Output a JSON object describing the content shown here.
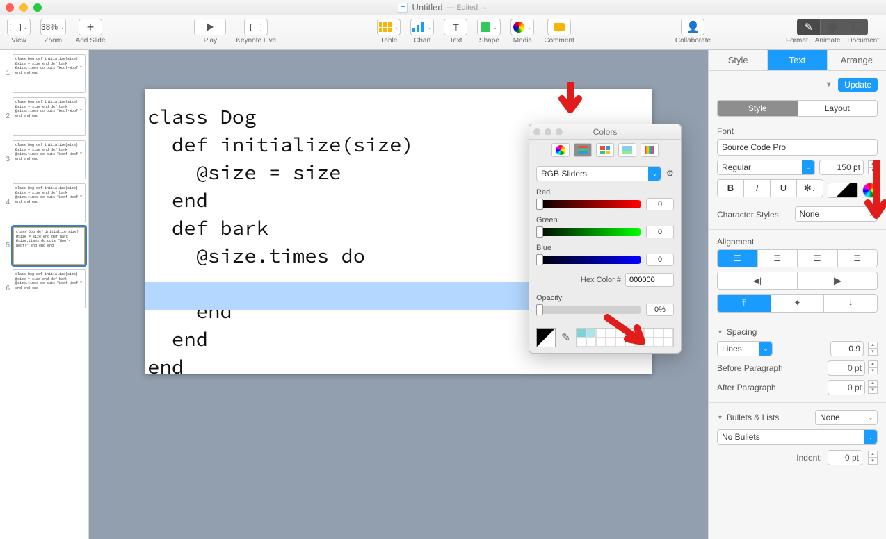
{
  "window": {
    "title": "Untitled",
    "edited_suffix": "— Edited"
  },
  "toolbar": {
    "view": "View",
    "zoom": "Zoom",
    "zoom_value": "38%",
    "add_slide": "Add Slide",
    "play": "Play",
    "keynote_live": "Keynote Live",
    "table": "Table",
    "chart": "Chart",
    "text": "Text",
    "shape": "Shape",
    "media": "Media",
    "comment": "Comment",
    "collaborate": "Collaborate",
    "format": "Format",
    "animate": "Animate",
    "document": "Document"
  },
  "slide_code": "class Dog\n  def initialize(size)\n    @size = size\n  end\n  def bark\n    @size.times do\n\n    end\n  end\nend",
  "thumb_code": "class Dog\n def initialize(size)\n  @size = size\n end\n def bark\n  @size.times do\n   puts \"Woof-Woof!\"\n  end\n end\nend",
  "inspector": {
    "tabs": {
      "style": "Style",
      "text": "Text",
      "arrange": "Arrange"
    },
    "update": "Update",
    "subtabs": {
      "style": "Style",
      "layout": "Layout"
    },
    "font_label": "Font",
    "font_name": "Source Code Pro",
    "font_variant": "Regular",
    "font_size": "150 pt",
    "bold": "B",
    "italic": "I",
    "underline": "U",
    "char_styles_label": "Character Styles",
    "char_styles_value": "None",
    "alignment_label": "Alignment",
    "spacing_label": "Spacing",
    "spacing_mode": "Lines",
    "spacing_value": "0.9",
    "before_para_label": "Before Paragraph",
    "before_para_value": "0 pt",
    "after_para_label": "After Paragraph",
    "after_para_value": "0 pt",
    "bullets_label": "Bullets & Lists",
    "bullets_value": "None",
    "bullets_option": "No Bullets",
    "indent_label": "Indent:",
    "indent_value": "0 pt"
  },
  "colors_popover": {
    "title": "Colors",
    "mode": "RGB Sliders",
    "red_label": "Red",
    "red_value": "0",
    "green_label": "Green",
    "green_value": "0",
    "blue_label": "Blue",
    "blue_value": "0",
    "hex_label": "Hex Color #",
    "hex_value": "000000",
    "opacity_label": "Opacity",
    "opacity_value": "0%"
  }
}
